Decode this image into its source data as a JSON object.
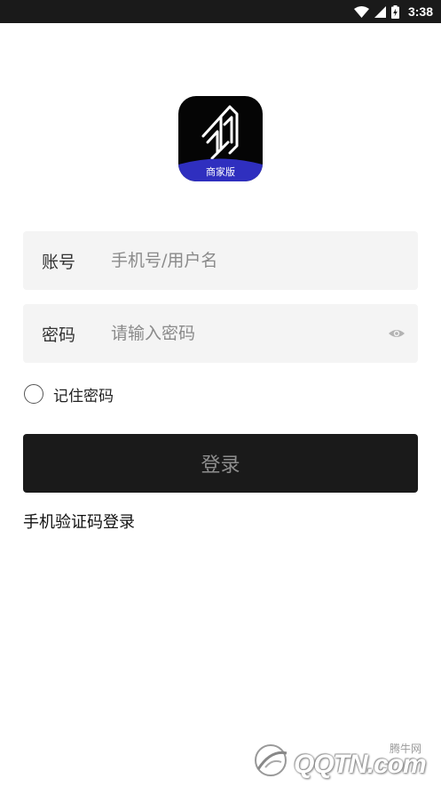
{
  "status_bar": {
    "time": "3:38",
    "icons": [
      "wifi-icon",
      "signal-icon",
      "battery-charging-icon"
    ]
  },
  "logo": {
    "band_label": "商家版",
    "band_color": "#2f2fbf",
    "background": "#050505"
  },
  "form": {
    "account": {
      "label": "账号",
      "placeholder": "手机号/用户名",
      "value": ""
    },
    "password": {
      "label": "密码",
      "placeholder": "请输入密码",
      "value": "",
      "toggle_icon": "eye-icon"
    },
    "remember": {
      "label": "记住密码",
      "checked": false
    }
  },
  "login_button": {
    "label": "登录"
  },
  "sms_login": {
    "label": "手机验证码登录"
  },
  "watermark": {
    "cn": "腾牛网",
    "en": "QQTN.com"
  }
}
